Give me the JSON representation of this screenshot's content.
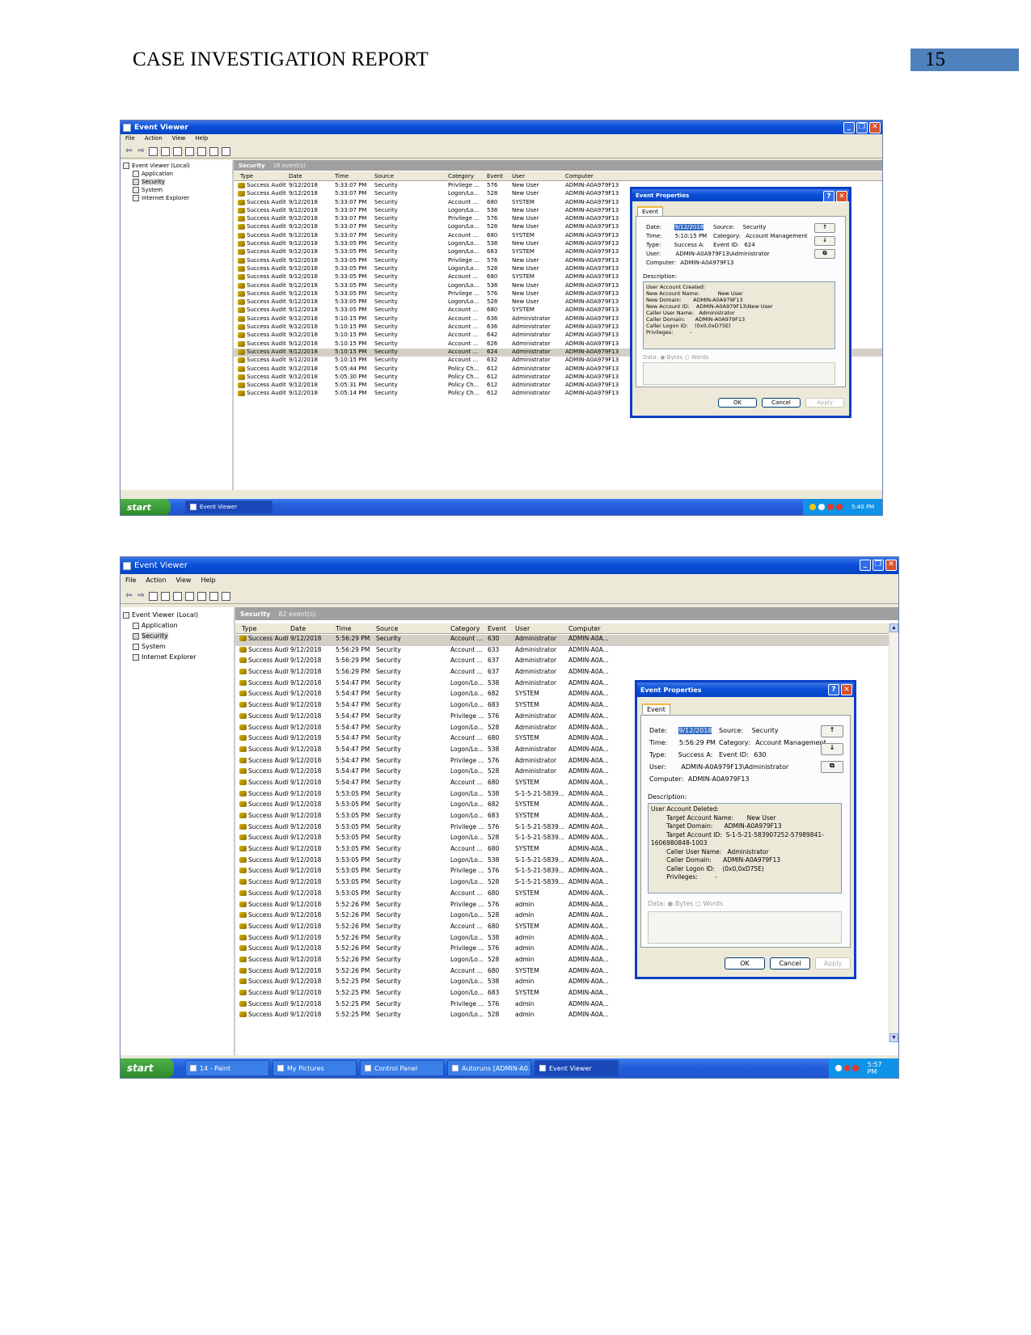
{
  "header": {
    "title": "CASE INVESTIGATION REPORT",
    "page_number": "15"
  },
  "menu": [
    "File",
    "Action",
    "View",
    "Help"
  ],
  "tree": [
    "Event Viewer (Local)",
    "Application",
    "Security",
    "System",
    "Internet Explorer"
  ],
  "columns": [
    "Type",
    "Date",
    "Time",
    "Source",
    "Category",
    "Event",
    "User",
    "Computer"
  ],
  "shot1": {
    "title": "Event Viewer",
    "pane_title": "Security",
    "pane_count": "26 event(s)",
    "rows": [
      [
        "Success Audit",
        "9/12/2018",
        "5:33:07 PM",
        "Security",
        "Privilege ...",
        "576",
        "New User",
        "ADMIN-A0A979F13"
      ],
      [
        "Success Audit",
        "9/12/2018",
        "5:33:07 PM",
        "Security",
        "Logon/Lo...",
        "528",
        "New User",
        "ADMIN-A0A979F13"
      ],
      [
        "Success Audit",
        "9/12/2018",
        "5:33:07 PM",
        "Security",
        "Account ...",
        "680",
        "SYSTEM",
        "ADMIN-A0A979F13"
      ],
      [
        "Success Audit",
        "9/12/2018",
        "5:33:07 PM",
        "Security",
        "Logon/Lo...",
        "538",
        "New User",
        "ADMIN-A0A979F13"
      ],
      [
        "Success Audit",
        "9/12/2018",
        "5:33:07 PM",
        "Security",
        "Privilege ...",
        "576",
        "New User",
        "ADMIN-A0A979F13"
      ],
      [
        "Success Audit",
        "9/12/2018",
        "5:33:07 PM",
        "Security",
        "Logon/Lo...",
        "528",
        "New User",
        "ADMIN-A0A979F13"
      ],
      [
        "Success Audit",
        "9/12/2018",
        "5:33:07 PM",
        "Security",
        "Account ...",
        "680",
        "SYSTEM",
        "ADMIN-A0A979F13"
      ],
      [
        "Success Audit",
        "9/12/2018",
        "5:33:05 PM",
        "Security",
        "Logon/Lo...",
        "538",
        "New User",
        "ADMIN-A0A979F13"
      ],
      [
        "Success Audit",
        "9/12/2018",
        "5:33:05 PM",
        "Security",
        "Logon/Lo...",
        "683",
        "SYSTEM",
        "ADMIN-A0A979F13"
      ],
      [
        "Success Audit",
        "9/12/2018",
        "5:33:05 PM",
        "Security",
        "Privilege ...",
        "576",
        "New User",
        "ADMIN-A0A979F13"
      ],
      [
        "Success Audit",
        "9/12/2018",
        "5:33:05 PM",
        "Security",
        "Logon/Lo...",
        "528",
        "New User",
        "ADMIN-A0A979F13"
      ],
      [
        "Success Audit",
        "9/12/2018",
        "5:33:05 PM",
        "Security",
        "Account ...",
        "680",
        "SYSTEM",
        "ADMIN-A0A979F13"
      ],
      [
        "Success Audit",
        "9/12/2018",
        "5:33:05 PM",
        "Security",
        "Logon/Lo...",
        "538",
        "New User",
        "ADMIN-A0A979F13"
      ],
      [
        "Success Audit",
        "9/12/2018",
        "5:33:05 PM",
        "Security",
        "Privilege ...",
        "576",
        "New User",
        "ADMIN-A0A979F13"
      ],
      [
        "Success Audit",
        "9/12/2018",
        "5:33:05 PM",
        "Security",
        "Logon/Lo...",
        "528",
        "New User",
        "ADMIN-A0A979F13"
      ],
      [
        "Success Audit",
        "9/12/2018",
        "5:33:05 PM",
        "Security",
        "Account ...",
        "680",
        "SYSTEM",
        "ADMIN-A0A979F13"
      ],
      [
        "Success Audit",
        "9/12/2018",
        "5:10:15 PM",
        "Security",
        "Account ...",
        "636",
        "Administrator",
        "ADMIN-A0A979F13"
      ],
      [
        "Success Audit",
        "9/12/2018",
        "5:10:15 PM",
        "Security",
        "Account ...",
        "636",
        "Administrator",
        "ADMIN-A0A979F13"
      ],
      [
        "Success Audit",
        "9/12/2018",
        "5:10:15 PM",
        "Security",
        "Account ...",
        "642",
        "Administrator",
        "ADMIN-A0A979F13"
      ],
      [
        "Success Audit",
        "9/12/2018",
        "5:10:15 PM",
        "Security",
        "Account ...",
        "626",
        "Administrator",
        "ADMIN-A0A979F13"
      ],
      [
        "Success Audit",
        "9/12/2018",
        "5:10:15 PM",
        "Security",
        "Account ...",
        "624",
        "Administrator",
        "ADMIN-A0A979F13"
      ],
      [
        "Success Audit",
        "9/12/2018",
        "5:10:15 PM",
        "Security",
        "Account ...",
        "632",
        "Administrator",
        "ADMIN-A0A979F13"
      ],
      [
        "Success Audit",
        "9/12/2018",
        "5:05:44 PM",
        "Security",
        "Policy Ch...",
        "612",
        "Administrator",
        "ADMIN-A0A979F13"
      ],
      [
        "Success Audit",
        "9/12/2018",
        "5:05:30 PM",
        "Security",
        "Policy Ch...",
        "612",
        "Administrator",
        "ADMIN-A0A979F13"
      ],
      [
        "Success Audit",
        "9/12/2018",
        "5:05:31 PM",
        "Security",
        "Policy Ch...",
        "612",
        "Administrator",
        "ADMIN-A0A979F13"
      ],
      [
        "Success Audit",
        "9/12/2018",
        "5:05:14 PM",
        "Security",
        "Policy Ch...",
        "612",
        "Administrator",
        "ADMIN-A0A979F13"
      ]
    ],
    "highlight_row": 20,
    "dialog": {
      "title": "Event Properties",
      "tab": "Event",
      "date_label": "Date:",
      "date": "9/12/2018",
      "source_label": "Source:",
      "source": "Security",
      "time_label": "Time:",
      "time": "5:10:15 PM",
      "category_label": "Category:",
      "category": "Account Management",
      "type_label": "Type:",
      "type": "Success A:",
      "eventid_label": "Event ID:",
      "eventid": "624",
      "user_label": "User:",
      "user": "ADMIN-A0A979F13\\Administrator",
      "computer_label": "Computer:",
      "computer": "ADMIN-A0A979F13",
      "description_label": "Description:",
      "description": [
        "User Account Created:",
        "New Account Name:           New User",
        "New Domain:       ADMIN-A0A979F13",
        "New Account ID:    ADMIN-A0A979F13\\New User",
        "Caller User Name:   Administrator",
        "Caller Domain:      ADMIN-A0A979F13",
        "Caller Logon ID:    (0x0,0xD75E)",
        "Privileges:          -"
      ],
      "data_label": "Data:",
      "bytes": "Bytes",
      "words": "Words",
      "ok": "OK",
      "cancel": "Cancel",
      "apply": "Apply"
    },
    "taskbar": {
      "start": "start",
      "tasks": [
        "Event Viewer"
      ],
      "clock": "5:40 PM"
    }
  },
  "shot2": {
    "title": "Event Viewer",
    "pane_title": "Security",
    "pane_count": "82 event(s)",
    "rows": [
      [
        "Success Audit",
        "9/12/2018",
        "5:56:29 PM",
        "Security",
        "Account ...",
        "630",
        "Administrator",
        "ADMIN-A0A..."
      ],
      [
        "Success Audit",
        "9/12/2018",
        "5:56:29 PM",
        "Security",
        "Account ...",
        "633",
        "Administrator",
        "ADMIN-A0A..."
      ],
      [
        "Success Audit",
        "9/12/2018",
        "5:56:29 PM",
        "Security",
        "Account ...",
        "637",
        "Administrator",
        "ADMIN-A0A..."
      ],
      [
        "Success Audit",
        "9/12/2018",
        "5:56:29 PM",
        "Security",
        "Account ...",
        "637",
        "Administrator",
        "ADMIN-A0A..."
      ],
      [
        "Success Audit",
        "9/12/2018",
        "5:54:47 PM",
        "Security",
        "Logon/Lo...",
        "538",
        "Administrator",
        "ADMIN-A0A..."
      ],
      [
        "Success Audit",
        "9/12/2018",
        "5:54:47 PM",
        "Security",
        "Logon/Lo...",
        "682",
        "SYSTEM",
        "ADMIN-A0A..."
      ],
      [
        "Success Audit",
        "9/12/2018",
        "5:54:47 PM",
        "Security",
        "Logon/Lo...",
        "683",
        "SYSTEM",
        "ADMIN-A0A..."
      ],
      [
        "Success Audit",
        "9/12/2018",
        "5:54:47 PM",
        "Security",
        "Privilege ...",
        "576",
        "Administrator",
        "ADMIN-A0A..."
      ],
      [
        "Success Audit",
        "9/12/2018",
        "5:54:47 PM",
        "Security",
        "Logon/Lo...",
        "528",
        "Administrator",
        "ADMIN-A0A..."
      ],
      [
        "Success Audit",
        "9/12/2018",
        "5:54:47 PM",
        "Security",
        "Account ...",
        "680",
        "SYSTEM",
        "ADMIN-A0A..."
      ],
      [
        "Success Audit",
        "9/12/2018",
        "5:54:47 PM",
        "Security",
        "Logon/Lo...",
        "538",
        "Administrator",
        "ADMIN-A0A..."
      ],
      [
        "Success Audit",
        "9/12/2018",
        "5:54:47 PM",
        "Security",
        "Privilege ...",
        "576",
        "Administrator",
        "ADMIN-A0A..."
      ],
      [
        "Success Audit",
        "9/12/2018",
        "5:54:47 PM",
        "Security",
        "Logon/Lo...",
        "528",
        "Administrator",
        "ADMIN-A0A..."
      ],
      [
        "Success Audit",
        "9/12/2018",
        "5:54:47 PM",
        "Security",
        "Account ...",
        "680",
        "SYSTEM",
        "ADMIN-A0A..."
      ],
      [
        "Success Audit",
        "9/12/2018",
        "5:53:05 PM",
        "Security",
        "Logon/Lo...",
        "538",
        "S-1-5-21-5839...",
        "ADMIN-A0A..."
      ],
      [
        "Success Audit",
        "9/12/2018",
        "5:53:05 PM",
        "Security",
        "Logon/Lo...",
        "682",
        "SYSTEM",
        "ADMIN-A0A..."
      ],
      [
        "Success Audit",
        "9/12/2018",
        "5:53:05 PM",
        "Security",
        "Logon/Lo...",
        "683",
        "SYSTEM",
        "ADMIN-A0A..."
      ],
      [
        "Success Audit",
        "9/12/2018",
        "5:53:05 PM",
        "Security",
        "Privilege ...",
        "576",
        "S-1-5-21-5839...",
        "ADMIN-A0A..."
      ],
      [
        "Success Audit",
        "9/12/2018",
        "5:53:05 PM",
        "Security",
        "Logon/Lo...",
        "528",
        "S-1-5-21-5839...",
        "ADMIN-A0A..."
      ],
      [
        "Success Audit",
        "9/12/2018",
        "5:53:05 PM",
        "Security",
        "Account ...",
        "680",
        "SYSTEM",
        "ADMIN-A0A..."
      ],
      [
        "Success Audit",
        "9/12/2018",
        "5:53:05 PM",
        "Security",
        "Logon/Lo...",
        "538",
        "S-1-5-21-5839...",
        "ADMIN-A0A..."
      ],
      [
        "Success Audit",
        "9/12/2018",
        "5:53:05 PM",
        "Security",
        "Privilege ...",
        "576",
        "S-1-5-21-5839...",
        "ADMIN-A0A..."
      ],
      [
        "Success Audit",
        "9/12/2018",
        "5:53:05 PM",
        "Security",
        "Logon/Lo...",
        "528",
        "S-1-5-21-5839...",
        "ADMIN-A0A..."
      ],
      [
        "Success Audit",
        "9/12/2018",
        "5:53:05 PM",
        "Security",
        "Account ...",
        "680",
        "SYSTEM",
        "ADMIN-A0A..."
      ],
      [
        "Success Audit",
        "9/12/2018",
        "5:52:26 PM",
        "Security",
        "Privilege ...",
        "576",
        "admin",
        "ADMIN-A0A..."
      ],
      [
        "Success Audit",
        "9/12/2018",
        "5:52:26 PM",
        "Security",
        "Logon/Lo...",
        "528",
        "admin",
        "ADMIN-A0A..."
      ],
      [
        "Success Audit",
        "9/12/2018",
        "5:52:26 PM",
        "Security",
        "Account ...",
        "680",
        "SYSTEM",
        "ADMIN-A0A..."
      ],
      [
        "Success Audit",
        "9/12/2018",
        "5:52:26 PM",
        "Security",
        "Logon/Lo...",
        "538",
        "admin",
        "ADMIN-A0A..."
      ],
      [
        "Success Audit",
        "9/12/2018",
        "5:52:26 PM",
        "Security",
        "Privilege ...",
        "576",
        "admin",
        "ADMIN-A0A..."
      ],
      [
        "Success Audit",
        "9/12/2018",
        "5:52:26 PM",
        "Security",
        "Logon/Lo...",
        "528",
        "admin",
        "ADMIN-A0A..."
      ],
      [
        "Success Audit",
        "9/12/2018",
        "5:52:26 PM",
        "Security",
        "Account ...",
        "680",
        "SYSTEM",
        "ADMIN-A0A..."
      ],
      [
        "Success Audit",
        "9/12/2018",
        "5:52:25 PM",
        "Security",
        "Logon/Lo...",
        "538",
        "admin",
        "ADMIN-A0A..."
      ],
      [
        "Success Audit",
        "9/12/2018",
        "5:52:25 PM",
        "Security",
        "Logon/Lo...",
        "683",
        "SYSTEM",
        "ADMIN-A0A..."
      ],
      [
        "Success Audit",
        "9/12/2018",
        "5:52:25 PM",
        "Security",
        "Privilege ...",
        "576",
        "admin",
        "ADMIN-A0A..."
      ],
      [
        "Success Audit",
        "9/12/2018",
        "5:52:25 PM",
        "Security",
        "Logon/Lo...",
        "528",
        "admin",
        "ADMIN-A0A..."
      ]
    ],
    "highlight_row": 0,
    "dialog": {
      "title": "Event Properties",
      "tab": "Event",
      "date_label": "Date:",
      "date": "9/12/2018",
      "source_label": "Source:",
      "source": "Security",
      "time_label": "Time:",
      "time": "5:56:29 PM",
      "category_label": "Category:",
      "category": "Account Management",
      "type_label": "Type:",
      "type": "Success A:",
      "eventid_label": "Event ID:",
      "eventid": "630",
      "user_label": "User:",
      "user": "ADMIN-A0A979F13\\Administrator",
      "computer_label": "Computer:",
      "computer": "ADMIN-A0A979F13",
      "description_label": "Description:",
      "description": [
        "User Account Deleted:",
        "        Target Account Name:       New User",
        "        Target Domain:      ADMIN-A0A979F13",
        "        Target Account ID:  S-1-5-21-583907252-57989841-",
        "1606980848-1003",
        "        Caller User Name:   Administrator",
        "        Caller Domain:      ADMIN-A0A979F13",
        "        Caller Logon ID:    (0x0,0xD75E)",
        "        Privileges:         -"
      ],
      "data_label": "Data:",
      "bytes": "Bytes",
      "words": "Words",
      "ok": "OK",
      "cancel": "Cancel",
      "apply": "Apply"
    },
    "taskbar": {
      "start": "start",
      "tasks": [
        "14 - Paint",
        "My Pictures",
        "Control Panel",
        "Autoruns [ADMIN-A0...",
        "Event Viewer"
      ],
      "clock": "5:57 PM"
    }
  }
}
